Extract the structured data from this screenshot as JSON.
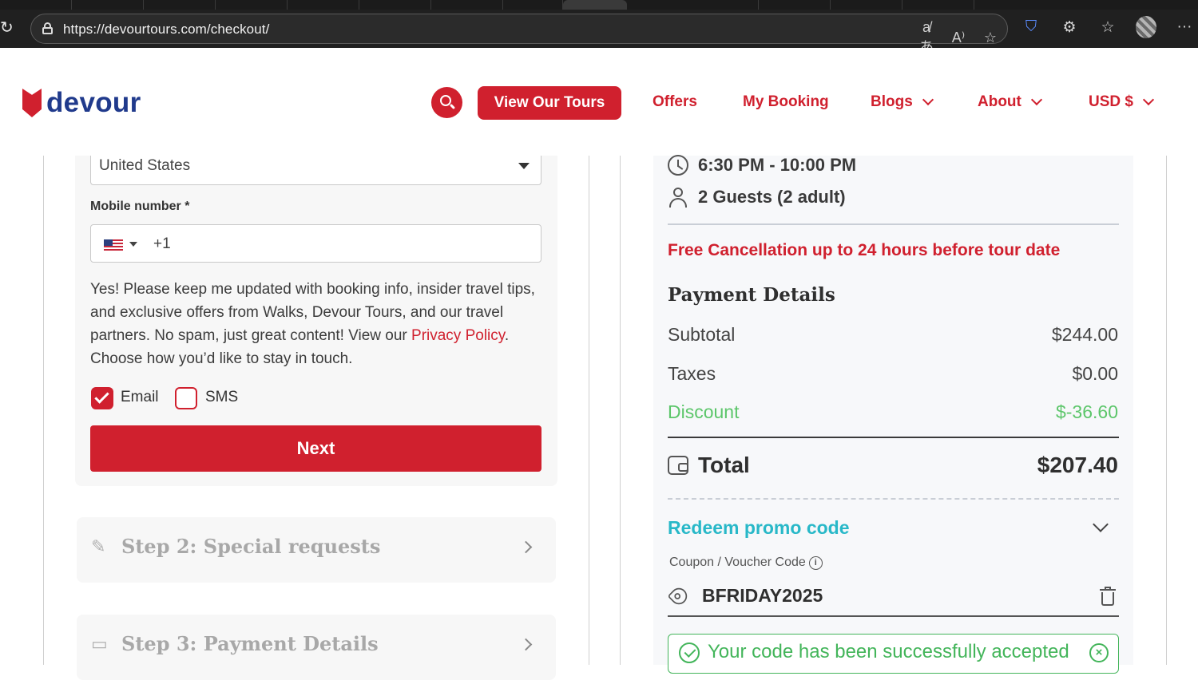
{
  "browser": {
    "url": "https://devourtours.com/checkout/",
    "icons": [
      "reload-icon",
      "lock-icon",
      "translate-icon",
      "read-aloud-icon",
      "favorite-star-icon",
      "shield-extension-icon",
      "extensions-icon",
      "favorites-icon",
      "profile-avatar",
      "more-icon"
    ]
  },
  "header": {
    "logo_text": "devour",
    "view_tours_label": "View Our Tours",
    "nav": {
      "offers": "Offers",
      "my_booking": "My Booking",
      "blogs": "Blogs",
      "about": "About",
      "currency": "USD $"
    },
    "brand_color": "#d0202e",
    "logo_color": "#203a8c"
  },
  "form": {
    "country_value": "United States",
    "mobile_label": "Mobile number *",
    "phone_prefix": "+1",
    "consent_text_1": "Yes! Please keep me updated with booking info, insider travel tips, and exclusive offers from Walks, Devour Tours, and our travel partners. No spam, just great content! View our ",
    "privacy_link": "Privacy Policy",
    "consent_text_2": ". Choose how you’d like to stay in touch.",
    "email_label": "Email",
    "email_checked": true,
    "sms_label": "SMS",
    "sms_checked": false,
    "next_label": "Next"
  },
  "steps": [
    {
      "title": "Step 2: Special requests",
      "icon": "pencil-icon"
    },
    {
      "title": "Step 3: Payment Details",
      "icon": "wallet-icon"
    }
  ],
  "summary": {
    "time": "6:30 PM - 10:00 PM",
    "guests": "2 Guests (2 adult)",
    "free_cancellation": "Free Cancellation up to 24 hours before tour date",
    "payment_title": "Payment Details",
    "subtotal_label": "Subtotal",
    "subtotal_value": "$244.00",
    "taxes_label": "Taxes",
    "taxes_value": "$0.00",
    "discount_label": "Discount",
    "discount_value": "$-36.60",
    "total_label": "Total",
    "total_value": "$207.40",
    "promo_title": "Redeem promo code",
    "coupon_label": "Coupon / Voucher Code",
    "coupon_value": "BFRIDAY2025",
    "success_message": "Your code has been successfully accepted",
    "discount_color": "#5cc66a",
    "promo_color": "#28b8c8"
  }
}
